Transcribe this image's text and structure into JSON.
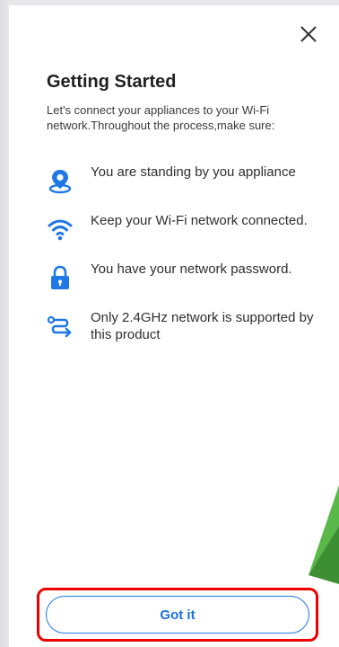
{
  "dialog": {
    "title": "Getting Started",
    "intro": "Let's connect your appliances to your Wi-Fi network.Throughout the process,make sure:",
    "close_icon": "close-icon"
  },
  "requirements": [
    {
      "icon": "location-pin-icon",
      "text": "You are standing by you appliance"
    },
    {
      "icon": "wifi-icon",
      "text": "Keep your Wi-Fi network connected."
    },
    {
      "icon": "lock-icon",
      "text": "You have your network password."
    },
    {
      "icon": "route-icon",
      "text": "Only 2.4GHz network is supported by this product"
    }
  ],
  "actions": {
    "got_it_label": "Got it"
  },
  "colors": {
    "accent": "#1f78e6",
    "highlight": "#ee0000",
    "title": "#1f1f1f",
    "background": "#ffffff"
  }
}
